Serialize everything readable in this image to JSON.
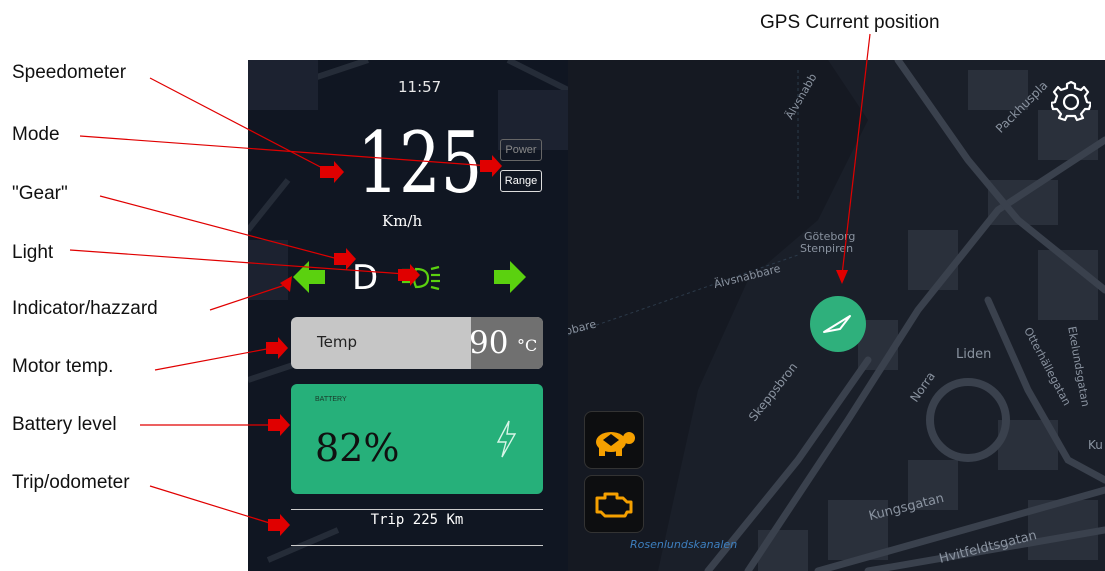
{
  "annotations": {
    "gps": "GPS Current position",
    "speedometer": "Speedometer",
    "mode": "Mode",
    "gear": "\"Gear\"",
    "light": "Light",
    "indicator": "Indicator/hazzard",
    "motor_temp": "Motor temp.",
    "battery": "Battery level",
    "trip": "Trip/odometer"
  },
  "dashboard": {
    "clock": "11:57",
    "speed": "125",
    "speed_unit": "Km/h",
    "mode_power": "Power",
    "mode_range": "Range",
    "gear": "D",
    "temp_label": "Temp",
    "temp_value": "90",
    "temp_unit": "°C",
    "battery_label": "BATTERY",
    "battery_value": "82%",
    "trip": "Trip 225 Km"
  },
  "map_labels": {
    "goteborg": "Göteborg",
    "stenpiren": "Stenpiren",
    "alvsnabbare": "Älvsnabbare",
    "alvsnabbare_top": "Älvsnabb",
    "skeppsbron": "Skeppsbron",
    "norra": "Norra",
    "liden": "Liden",
    "otterhallegatan": "Otterhällegatan",
    "ekelundsgatan": "Ekelundsgatan",
    "kungsgatan": "Kungsgatan",
    "hvitfeldtsgatan": "Hvitfeldtsgatan",
    "packhusplatsen": "Packhuspla",
    "rosenlundskanalen": "Rosenlundskanalen",
    "ku": "Ku",
    "abbare": "abbare"
  },
  "colors": {
    "battery": "#26b07a",
    "gps_marker": "#2fb07c",
    "indicator": "#5bd10f",
    "warning_icon": "#f5a000",
    "arrow": "#e00000"
  },
  "icons": {
    "settings": "gear-icon",
    "turtle": "turtle-icon",
    "engine": "engine-warning-icon",
    "light": "headlight-icon",
    "battery_bolt": "lightning-icon"
  }
}
